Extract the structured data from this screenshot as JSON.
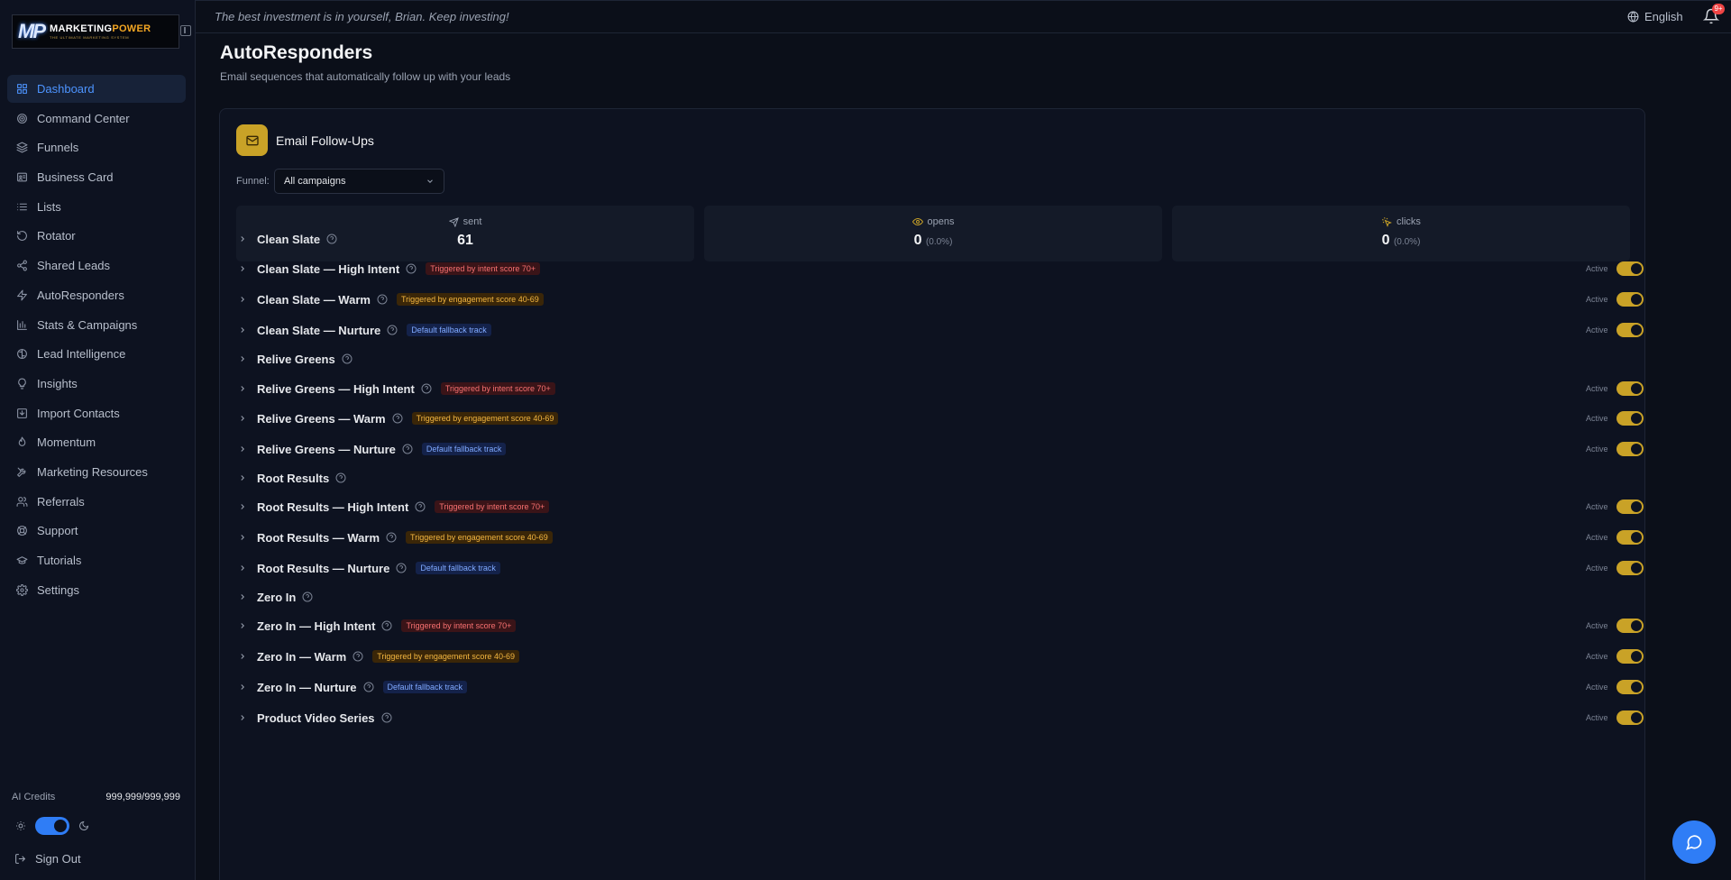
{
  "sidebar": {
    "logo": {
      "mark": "MP",
      "name_a": "MARKETING",
      "name_b": "POWER",
      "tagline": "THE ULTIMATE MARKETING SYSTEM"
    },
    "items": [
      {
        "label": "Dashboard",
        "icon": "grid-icon"
      },
      {
        "label": "Command Center",
        "icon": "target-icon"
      },
      {
        "label": "Funnels",
        "icon": "layers-icon"
      },
      {
        "label": "Business Card",
        "icon": "id-card-icon"
      },
      {
        "label": "Lists",
        "icon": "list-icon"
      },
      {
        "label": "Rotator",
        "icon": "rotate-icon"
      },
      {
        "label": "Shared Leads",
        "icon": "share-icon"
      },
      {
        "label": "AutoResponders",
        "icon": "bolt-icon"
      },
      {
        "label": "Stats & Campaigns",
        "icon": "bar-chart-icon"
      },
      {
        "label": "Lead Intelligence",
        "icon": "brain-icon"
      },
      {
        "label": "Insights",
        "icon": "lightbulb-icon"
      },
      {
        "label": "Import Contacts",
        "icon": "import-icon"
      },
      {
        "label": "Momentum",
        "icon": "flame-icon"
      },
      {
        "label": "Marketing Resources",
        "icon": "tools-icon"
      },
      {
        "label": "Referrals",
        "icon": "users-icon"
      },
      {
        "label": "Support",
        "icon": "lifebuoy-icon"
      },
      {
        "label": "Tutorials",
        "icon": "graduation-cap-icon"
      },
      {
        "label": "Settings",
        "icon": "gear-icon"
      }
    ],
    "active_index": 0,
    "credits_label": "AI Credits",
    "credits_value": "999,999/999,999",
    "signout_label": "Sign Out"
  },
  "topbar": {
    "quote": "The best investment is in yourself, Brian. Keep investing!",
    "language": "English",
    "notification_badge": "9+"
  },
  "header": {
    "title": "AutoResponders",
    "subtitle": "Email sequences that automatically follow up with your leads"
  },
  "card": {
    "title": "Email Follow-Ups",
    "funnel_label": "Funnel:",
    "funnel_value": "All campaigns",
    "stats": [
      {
        "label": "sent",
        "value": "61",
        "pct": "",
        "icon": "send-icon"
      },
      {
        "label": "opens",
        "value": "0",
        "pct": "(0.0%)",
        "icon": "eye-icon"
      },
      {
        "label": "clicks",
        "value": "0",
        "pct": "(0.0%)",
        "icon": "click-icon"
      }
    ],
    "active_label": "Active",
    "sequences": [
      {
        "name": "Clean Slate",
        "tag": "",
        "tag_style": "",
        "toggle": false
      },
      {
        "name": "Clean Slate — High Intent",
        "tag": "Triggered by intent score 70+",
        "tag_style": "red",
        "toggle": true
      },
      {
        "name": "Clean Slate — Warm",
        "tag": "Triggered by engagement score 40-69",
        "tag_style": "amber",
        "toggle": true
      },
      {
        "name": "Clean Slate — Nurture",
        "tag": "Default fallback track",
        "tag_style": "blue",
        "toggle": true
      },
      {
        "name": "Relive Greens",
        "tag": "",
        "tag_style": "",
        "toggle": false
      },
      {
        "name": "Relive Greens — High Intent",
        "tag": "Triggered by intent score 70+",
        "tag_style": "red",
        "toggle": true
      },
      {
        "name": "Relive Greens — Warm",
        "tag": "Triggered by engagement score 40-69",
        "tag_style": "amber",
        "toggle": true
      },
      {
        "name": "Relive Greens — Nurture",
        "tag": "Default fallback track",
        "tag_style": "blue",
        "toggle": true
      },
      {
        "name": "Root Results",
        "tag": "",
        "tag_style": "",
        "toggle": false
      },
      {
        "name": "Root Results — High Intent",
        "tag": "Triggered by intent score 70+",
        "tag_style": "red",
        "toggle": true
      },
      {
        "name": "Root Results — Warm",
        "tag": "Triggered by engagement score 40-69",
        "tag_style": "amber",
        "toggle": true
      },
      {
        "name": "Root Results — Nurture",
        "tag": "Default fallback track",
        "tag_style": "blue",
        "toggle": true
      },
      {
        "name": "Zero In",
        "tag": "",
        "tag_style": "",
        "toggle": false
      },
      {
        "name": "Zero In — High Intent",
        "tag": "Triggered by intent score 70+",
        "tag_style": "red",
        "toggle": true
      },
      {
        "name": "Zero In — Warm",
        "tag": "Triggered by engagement score 40-69",
        "tag_style": "amber",
        "toggle": true
      },
      {
        "name": "Zero In — Nurture",
        "tag": "Default fallback track",
        "tag_style": "blue",
        "toggle": true
      },
      {
        "name": "Product Video Series",
        "tag": "",
        "tag_style": "",
        "toggle": true
      }
    ]
  },
  "colors": {
    "accent_blue": "#2f7df6",
    "accent_gold": "#c9a227",
    "background": "#0b0f19"
  }
}
